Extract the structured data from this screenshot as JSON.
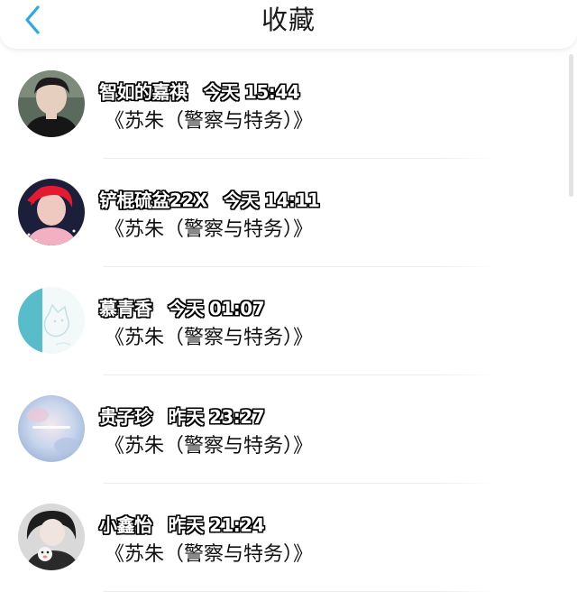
{
  "header": {
    "title": "收藏",
    "back_icon": "chevron-left-icon",
    "accent_color": "#2ea7e8"
  },
  "items": [
    {
      "name": "智如的嘉祺",
      "time": "今天 15:44",
      "title": "《苏朱（警察与特务）》"
    },
    {
      "name": "铲棍硫盆22X",
      "time": "今天 14:11",
      "title": "《苏朱（警察与特务）》"
    },
    {
      "name": "慕青香",
      "time": "今天 01:07",
      "title": "《苏朱（警察与特务）》"
    },
    {
      "name": "贵子珍",
      "time": "昨天 23:27",
      "title": "《苏朱（警察与特务）》"
    },
    {
      "name": "小鑫怡",
      "time": "昨天 21:24",
      "title": "《苏朱（警察与特务）》"
    }
  ]
}
